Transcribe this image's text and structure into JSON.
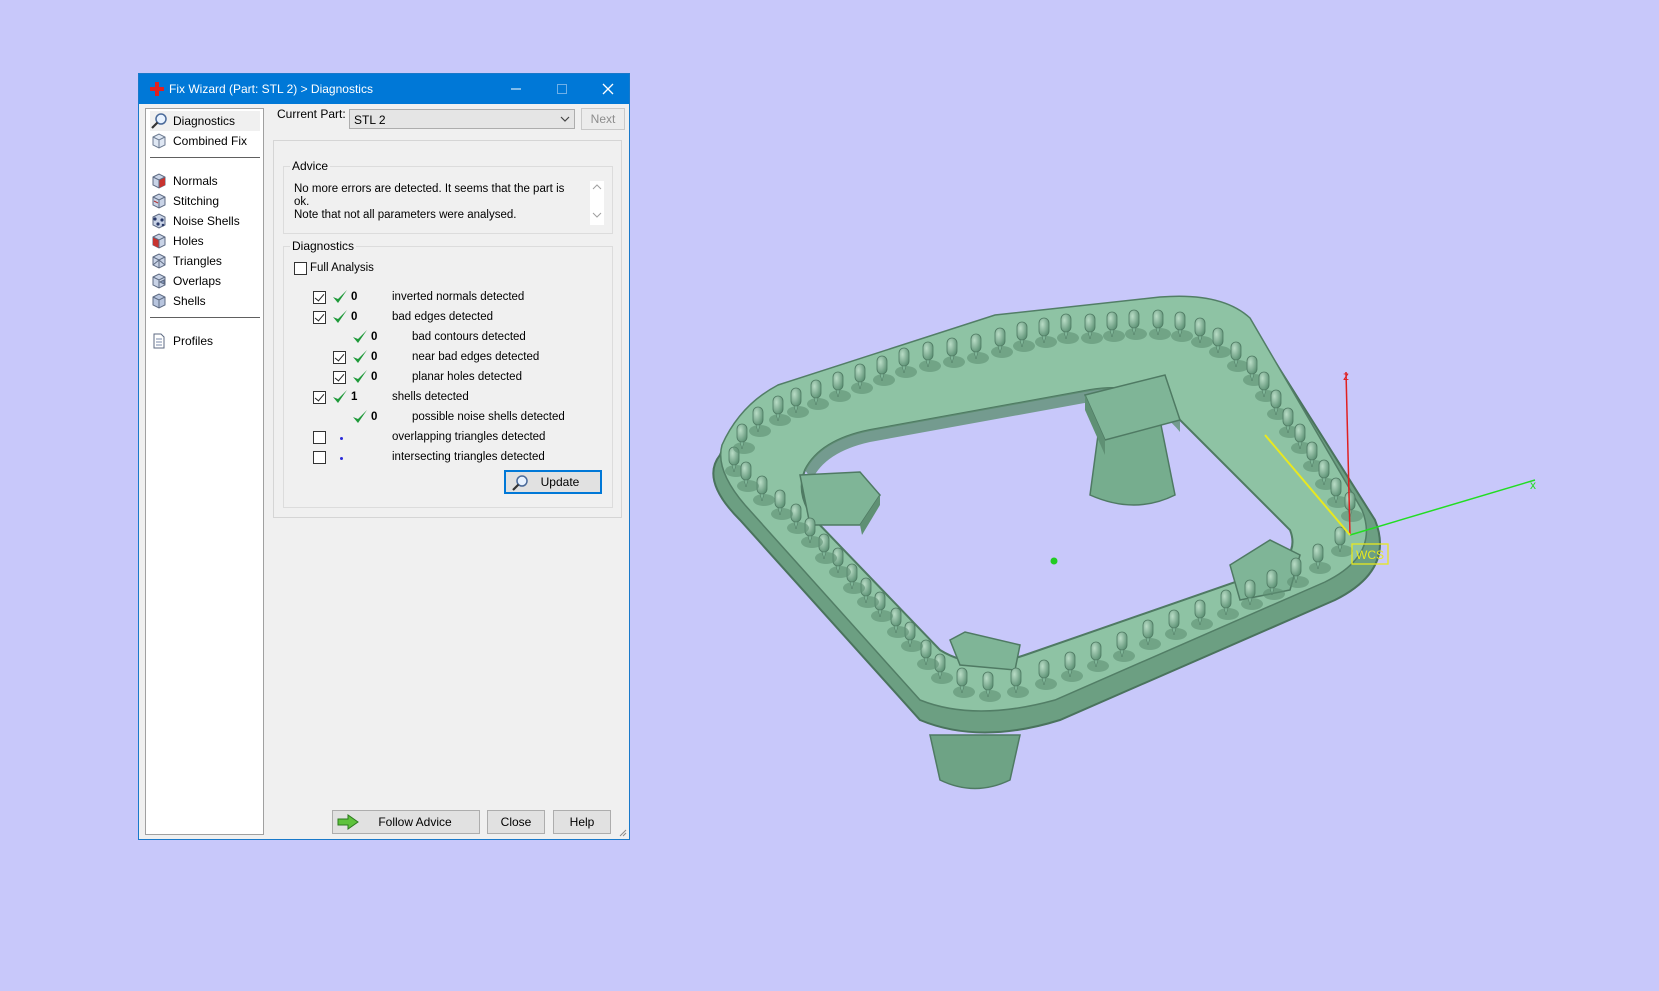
{
  "colors": {
    "viewport_bg": "#c8c8fa",
    "title_bar": "#0078d7",
    "model": "#7fb597",
    "check_green": "#1f9a3a"
  },
  "window": {
    "title": "Fix Wizard (Part: STL 2) > Diagnostics",
    "icon": "red-cross-icon"
  },
  "nav": {
    "items": [
      {
        "label": "Diagnostics",
        "icon": "magnifier-icon"
      },
      {
        "label": "Combined Fix",
        "icon": "cube-icon"
      },
      {
        "label": "Normals",
        "icon": "normals-cube-icon"
      },
      {
        "label": "Stitching",
        "icon": "stitching-cube-icon"
      },
      {
        "label": "Noise Shells",
        "icon": "noise-shells-icon"
      },
      {
        "label": "Holes",
        "icon": "holes-cube-icon"
      },
      {
        "label": "Triangles",
        "icon": "triangles-cube-icon"
      },
      {
        "label": "Overlaps",
        "icon": "overlaps-cube-icon"
      },
      {
        "label": "Shells",
        "icon": "shells-cube-icon"
      },
      {
        "label": "Profiles",
        "icon": "document-icon"
      }
    ]
  },
  "top": {
    "current_part_label": "Current Part:",
    "current_part_value": "STL 2",
    "next_label": "Next"
  },
  "advice": {
    "title": "Advice",
    "line1": "No more errors are detected. It seems that the part is ok.",
    "line2": "Note that not all parameters were analysed."
  },
  "diagnostics": {
    "title": "Diagnostics",
    "full_analysis_label": "Full Analysis",
    "rows": [
      {
        "count": "0",
        "text": "inverted normals detected"
      },
      {
        "count": "0",
        "text": "bad edges detected"
      },
      {
        "count": "0",
        "text": "bad contours detected"
      },
      {
        "count": "0",
        "text": "near bad edges detected"
      },
      {
        "count": "0",
        "text": "planar holes detected"
      },
      {
        "count": "1",
        "text": "shells detected"
      },
      {
        "count": "0",
        "text": "possible noise shells detected"
      },
      {
        "count": "",
        "text": "overlapping triangles detected"
      },
      {
        "count": "",
        "text": "intersecting triangles detected"
      }
    ],
    "update_label": "Update"
  },
  "footer": {
    "follow_advice_label": "Follow Advice",
    "close_label": "Close",
    "help_label": "Help"
  },
  "axes": {
    "x_label": "x",
    "z_label": "z",
    "wcs_label": "WCS"
  }
}
